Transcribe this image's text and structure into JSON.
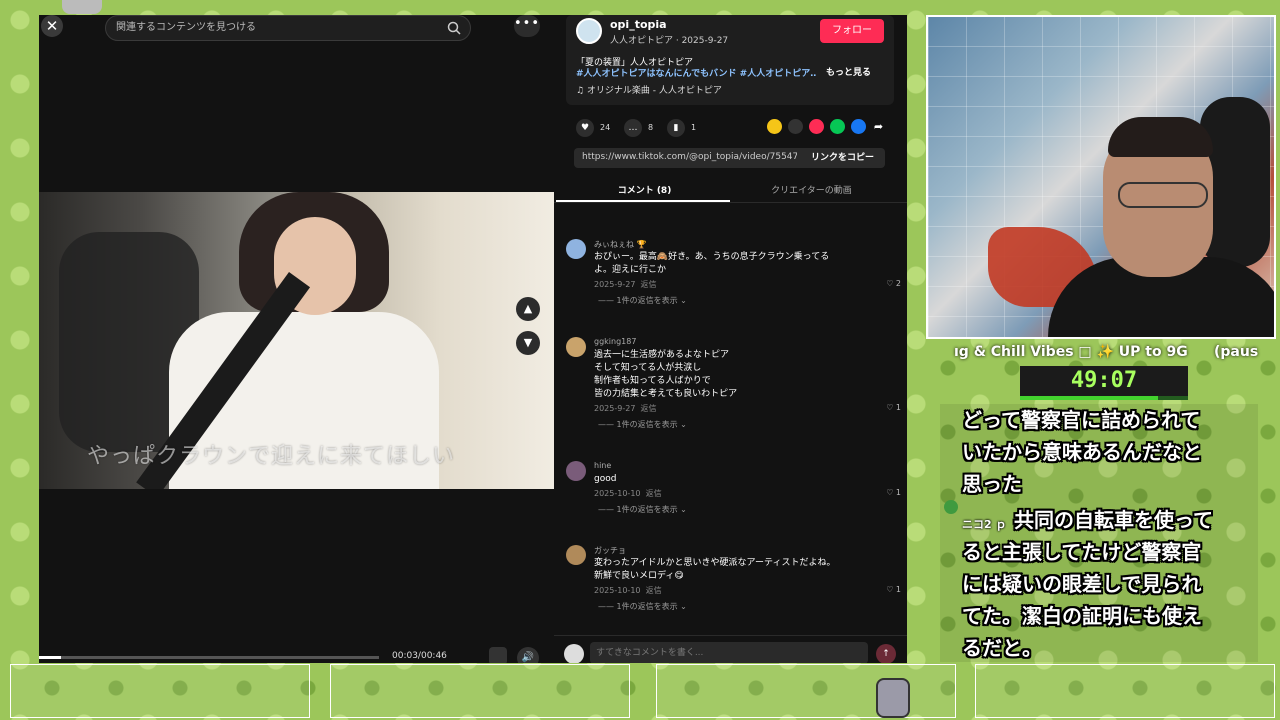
{
  "tiktok": {
    "search_placeholder": "関連するコンテンツを見つける",
    "close_glyph": "✕",
    "more_glyph": "•••",
    "video": {
      "subtitle": "やっぱクラウンで迎えに来てほしい",
      "time": "00:03/00:46",
      "progress": 0.065
    },
    "author": {
      "name": "opi_topia",
      "sub": "人人オピトピア · 2025-9-27",
      "follow": "フォロー",
      "description": "「夏の装置」人人オピトピア",
      "tags": "#人人オピトピアはなんにんでもバンド #人人オピトピア…",
      "more": "もっと見る",
      "music": "♫  オリジナル楽曲 - 人人オピトピア"
    },
    "actions": {
      "likes": "24",
      "comments": "8",
      "saves": "1"
    },
    "share_colors": [
      "#f5c518",
      "#333333",
      "#fe2c55",
      "#06c755",
      "#1877f2"
    ],
    "link": {
      "url": "https://www.tiktok.com/@opi_topia/video/755474...",
      "copy": "リンクをコピー"
    },
    "tabs": [
      "コメント (8)",
      "クリエイターの動画"
    ],
    "comments": [
      {
        "user": "みぃねぇね 🏆",
        "text": "おぴぃー。最高🙈好き。あ、うちの息子クラウン乗ってる\nよ。迎えに行こか",
        "date": "2025-9-27",
        "reply": "返信",
        "likes": "2",
        "replies": "1件の返信を表示",
        "color": "#8fb3e0"
      },
      {
        "user": "ggking187",
        "text": "過去一に生活感があるよなトピア\nそして知ってる人が共涙し\n制作者も知ってる人ばかりで\n皆の力結集と考えても良いわトピア",
        "date": "2025-9-27",
        "reply": "返信",
        "likes": "1",
        "replies": "1件の返信を表示",
        "color": "#c9a36b"
      },
      {
        "user": "hine",
        "text": "good",
        "date": "2025-10-10",
        "reply": "返信",
        "likes": "1",
        "replies": "1件の返信を表示",
        "color": "#7a5c7a"
      },
      {
        "user": "ガッチョ",
        "text": "変わったアイドルかと思いきや硬派なアーティストだよね。\n新鮮で良いメロディ😋",
        "date": "2025-10-10",
        "reply": "返信",
        "likes": "1",
        "replies": "1件の返信を表示",
        "color": "#b08a5a"
      }
    ],
    "comment_placeholder": "すてきなコメントを書く..."
  },
  "stream": {
    "ticker": "ıg & Chill Vibes □ ✨ UP to 9G",
    "ticker_paused": "(paus",
    "timer": "49:07",
    "timer_progress": 0.82,
    "chat_line_1": "どって警察官に詰められて\nいたから意味あるんだなと\n思った",
    "chat_user": "ニコ2 ｐ",
    "chat_line_2": "共同の自転車を使って\nると主張してたけど警察官\nには疑いの眼差しで見られ\nてた。潔白の証明にも使え\nるだと。"
  }
}
